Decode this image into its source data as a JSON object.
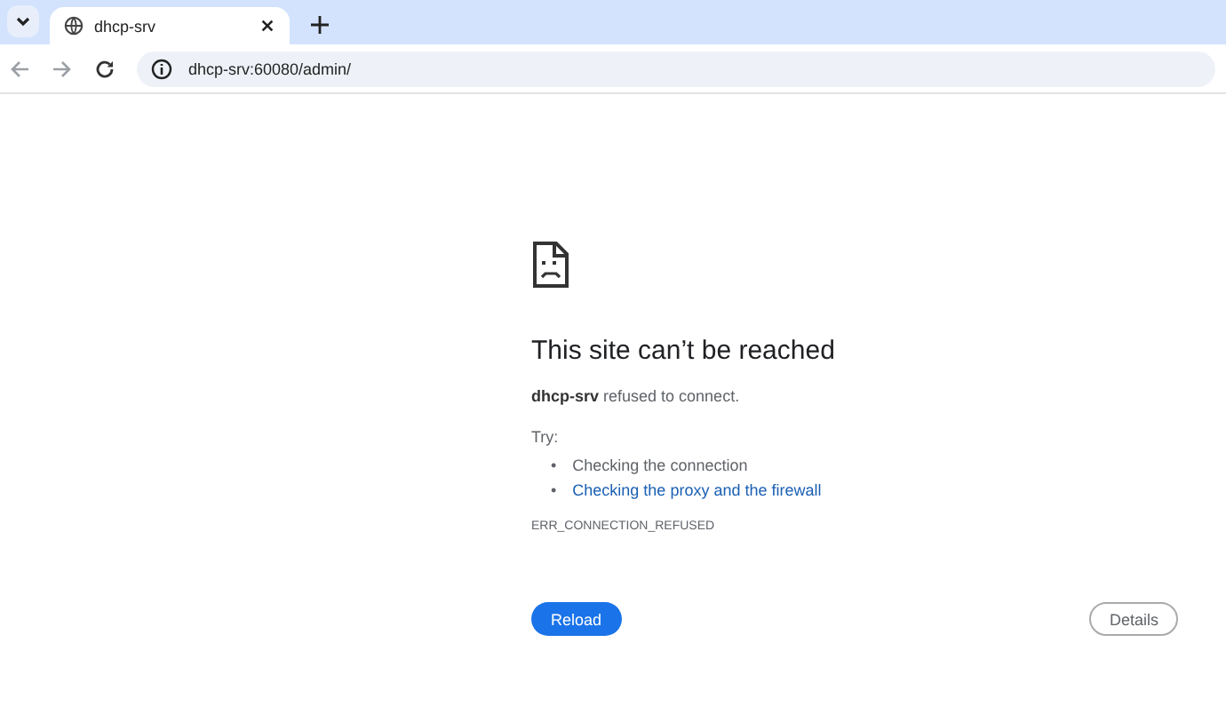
{
  "tabs": [
    {
      "title": "dhcp-srv",
      "selected": true
    }
  ],
  "address_bar": {
    "url": "dhcp-srv:60080/admin/"
  },
  "error": {
    "title": "This site can’t be reached",
    "message": "**dhcp-srv** refused to connect.",
    "try_label": "Try:",
    "suggestions": [
      {
        "kind": "text",
        "bullet": "•",
        "label": "Checking the connection"
      },
      {
        "kind": "link",
        "bullet": "•",
        "label": "Checking the proxy and the firewall"
      }
    ],
    "code": "ERR_CONNECTION_REFUSED"
  },
  "buttons": {
    "primary": "Reload",
    "secondary": "Details"
  }
}
